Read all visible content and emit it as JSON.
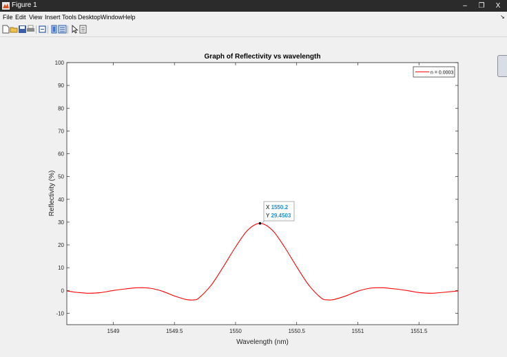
{
  "window": {
    "title": "Figure 1",
    "minimize_glyph": "–",
    "restore_glyph": "❐",
    "close_glyph": "X"
  },
  "menu": {
    "items": [
      "File",
      "Edit",
      "View",
      "Insert",
      "Tools",
      "Desktop",
      "Window",
      "Help"
    ],
    "dock_arrow": "↘"
  },
  "toolbar": {
    "icons": [
      "new-figure-icon",
      "open-file-icon",
      "save-icon",
      "print-icon",
      "link-plot-icon",
      "insert-colorbar-icon",
      "insert-legend-icon",
      "edit-plot-icon",
      "property-inspector-icon"
    ]
  },
  "chart_data": {
    "type": "line",
    "title": "Graph of Reflectivity vs wavelength",
    "xlabel": "Wavelength (nm)",
    "ylabel": "Reflectivity (%)",
    "xlim": [
      1548.62,
      1551.82
    ],
    "ylim": [
      -15,
      100
    ],
    "xticks": [
      1549,
      1549.5,
      1550,
      1550.5,
      1551,
      1551.5
    ],
    "xtick_labels": [
      "1549",
      "1549.5",
      "1550",
      "1550.5",
      "1551",
      "1551.5"
    ],
    "yticks": [
      -10,
      0,
      10,
      20,
      30,
      40,
      50,
      60,
      70,
      80,
      90,
      100
    ],
    "ytick_labels": [
      "-10",
      "0",
      "10",
      "20",
      "30",
      "40",
      "50",
      "60",
      "70",
      "80",
      "90",
      "100"
    ],
    "grid": false,
    "legend_position": "top-right",
    "series": [
      {
        "name": "n = 0.0003",
        "color": "#ff0000",
        "x": [
          1548.62,
          1548.7,
          1548.8,
          1548.9,
          1549.0,
          1549.1,
          1549.2,
          1549.3,
          1549.4,
          1549.5,
          1549.6,
          1549.66,
          1549.7,
          1549.8,
          1549.9,
          1550.0,
          1550.1,
          1550.2,
          1550.3,
          1550.4,
          1550.5,
          1550.6,
          1550.7,
          1550.75,
          1550.8,
          1550.9,
          1551.0,
          1551.1,
          1551.2,
          1551.3,
          1551.4,
          1551.5,
          1551.6,
          1551.7,
          1551.82
        ],
        "y": [
          -0.2,
          -0.8,
          -1.2,
          -0.9,
          0.0,
          0.7,
          1.2,
          1.0,
          -0.3,
          -2.4,
          -4.0,
          -4.1,
          -3.3,
          2.3,
          10.4,
          19.1,
          26.5,
          29.45,
          26.5,
          19.1,
          10.4,
          2.3,
          -3.3,
          -4.1,
          -4.0,
          -2.4,
          -0.3,
          1.0,
          1.2,
          0.7,
          0.0,
          -0.9,
          -1.2,
          -0.8,
          -0.2
        ]
      }
    ],
    "datatip": {
      "x_label": "X",
      "x_value": "1550.2",
      "y_label": "Y",
      "y_value": "29.4503",
      "x": 1550.2,
      "y": 29.4503
    }
  }
}
